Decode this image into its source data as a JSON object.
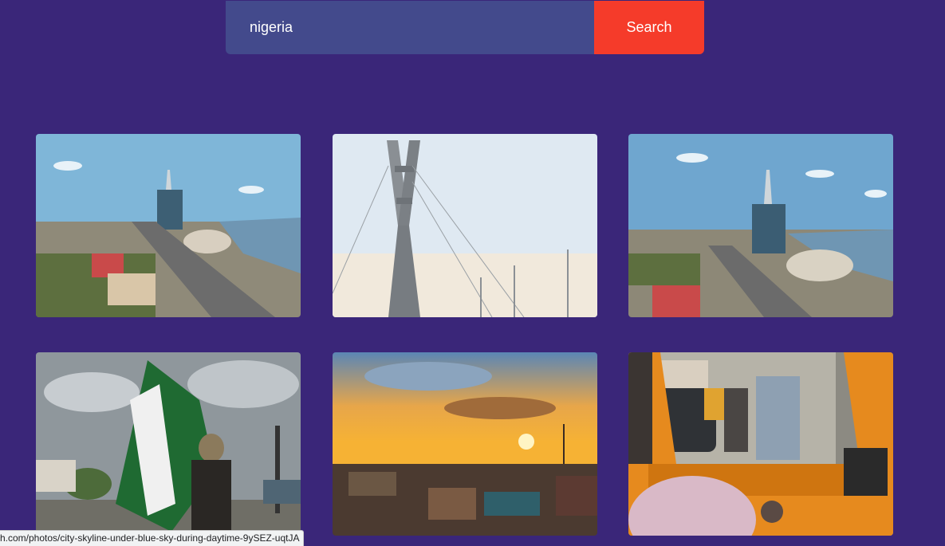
{
  "search": {
    "value": "nigeria",
    "button_label": "Search"
  },
  "photos": [
    {
      "subject": "lagos-skyline-aerial"
    },
    {
      "subject": "lekki-bridge-pylon"
    },
    {
      "subject": "lagos-skyline-aerial"
    },
    {
      "subject": "person-with-nigerian-flag"
    },
    {
      "subject": "sunset-over-city"
    },
    {
      "subject": "view-from-tricycle"
    }
  ],
  "status_bar": {
    "url": "h.com/photos/city-skyline-under-blue-sky-during-daytime-9ySEZ-uqtJA"
  },
  "colors": {
    "background": "#3a2679",
    "search_field": "#434a8c",
    "search_button": "#f53b2a"
  }
}
